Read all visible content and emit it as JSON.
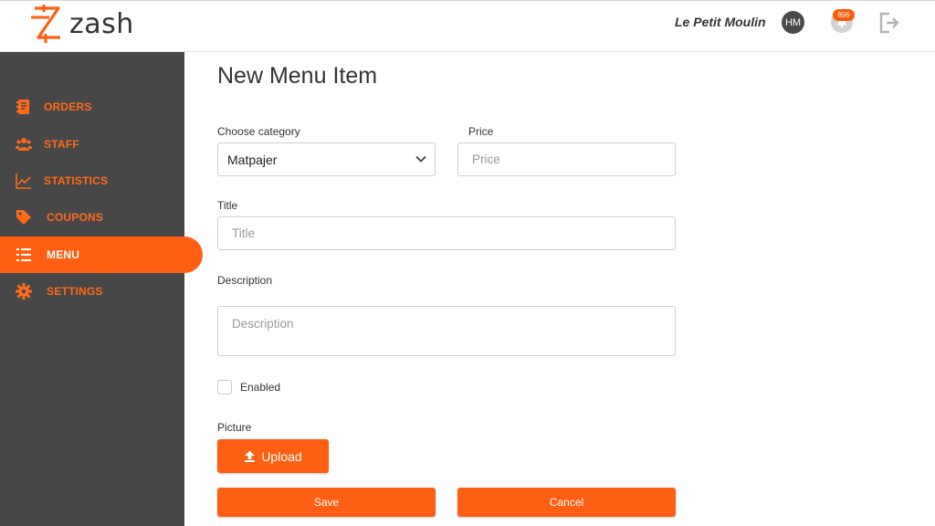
{
  "brand": {
    "name": "zash",
    "accent": "#ff5f12"
  },
  "header": {
    "restaurant": "Le Petit Moulin",
    "avatar_initials": "HM",
    "notifications_count": "896"
  },
  "sidebar": {
    "items": [
      {
        "label": "ORDERS",
        "icon": "orders-icon"
      },
      {
        "label": "STAFF",
        "icon": "staff-icon"
      },
      {
        "label": "STATISTICS",
        "icon": "statistics-icon"
      },
      {
        "label": "COUPONS",
        "icon": "tag-icon"
      },
      {
        "label": "MENU",
        "icon": "list-icon",
        "active": true
      },
      {
        "label": "SETTINGS",
        "icon": "gear-icon"
      }
    ]
  },
  "form": {
    "title": "New Menu Item",
    "category": {
      "label": "Choose category",
      "value": "Matpajer"
    },
    "price": {
      "label": "Price",
      "placeholder": "Price"
    },
    "title_field": {
      "label": "Title",
      "placeholder": "Title"
    },
    "description": {
      "label": "Description",
      "placeholder": "Description"
    },
    "enabled": {
      "label": "Enabled",
      "checked": false
    },
    "picture": {
      "label": "Picture",
      "upload_label": "Upload"
    },
    "save_label": "Save",
    "cancel_label": "Cancel"
  }
}
